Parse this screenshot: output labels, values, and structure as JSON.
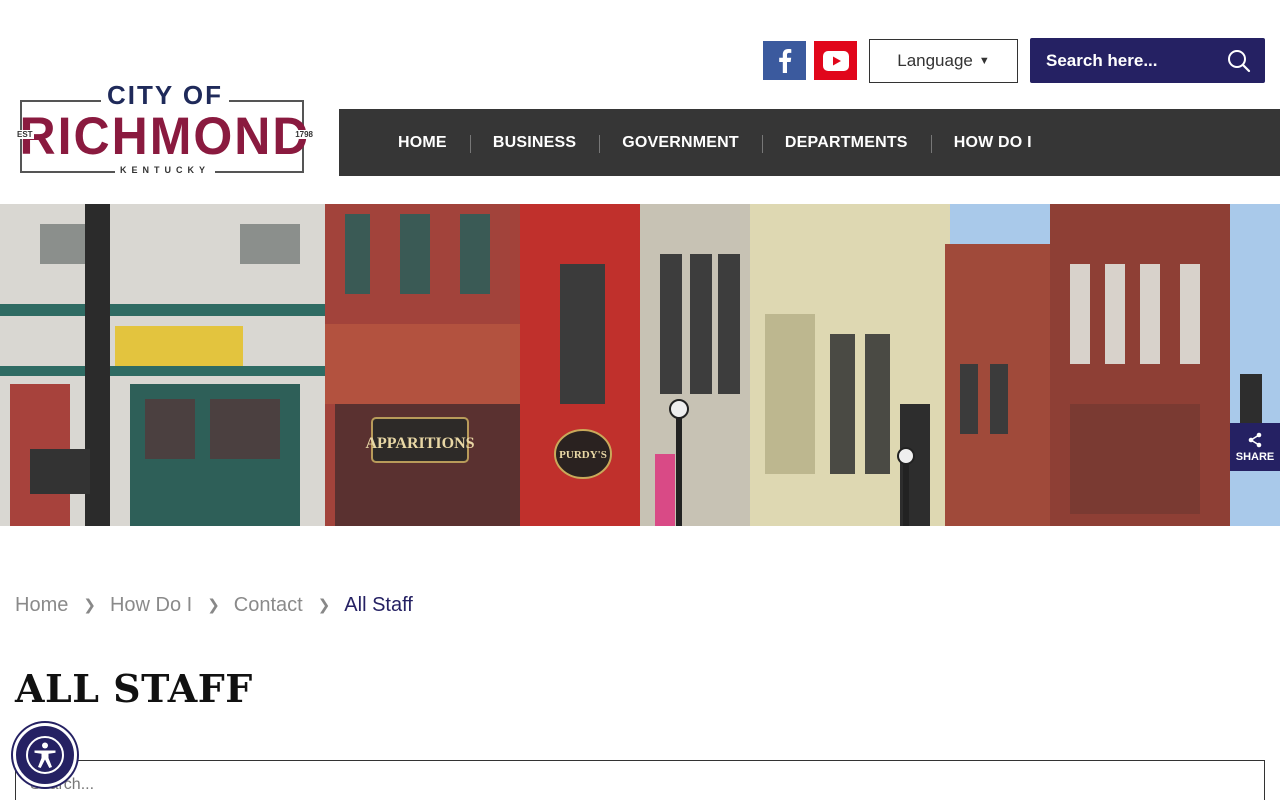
{
  "logo": {
    "line1": "CITY OF",
    "line2": "RICHMOND",
    "est": "EST",
    "year": "1798",
    "state": "KENTUCKY"
  },
  "header": {
    "social": [
      {
        "icon": "facebook-icon",
        "color": "#3b5a9e"
      },
      {
        "icon": "youtube-icon",
        "color": "#e1061b"
      }
    ],
    "language_label": "Language",
    "search_placeholder": "Search here...",
    "accent_color": "#252163"
  },
  "nav": {
    "items": [
      "HOME",
      "BUSINESS",
      "GOVERNMENT",
      "DEPARTMENTS",
      "HOW DO I"
    ]
  },
  "hero": {
    "shop_signs": [
      "APPARITIONS",
      "PURDY'S"
    ]
  },
  "share": {
    "label": "SHARE"
  },
  "breadcrumb": [
    "Home",
    "How Do I",
    "Contact",
    "All Staff"
  ],
  "page": {
    "title": "ALL STAFF",
    "search_placeholder": "Search..."
  }
}
